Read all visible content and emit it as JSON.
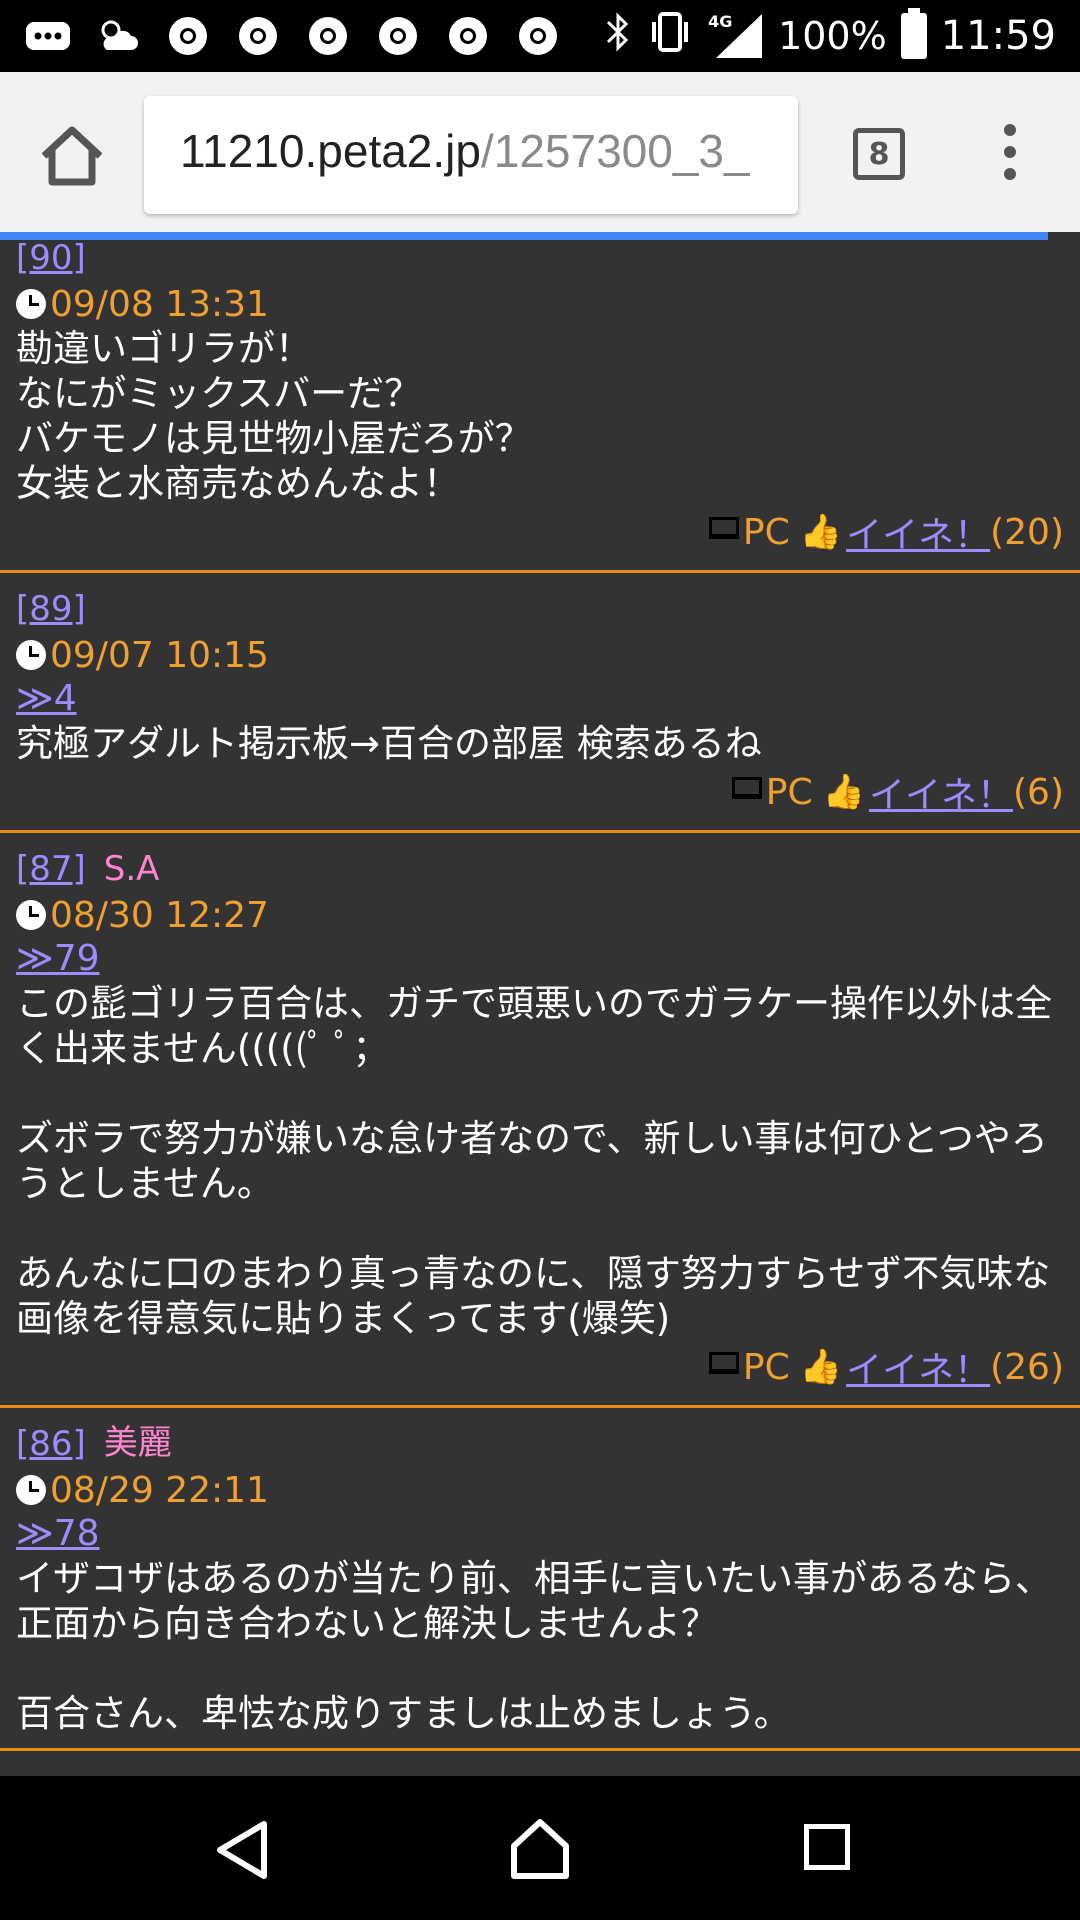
{
  "status_bar": {
    "battery": "100%",
    "time": "11:59",
    "network": "4G",
    "icons": [
      "more-icon",
      "weather-icon",
      "chrome-icon",
      "chrome-icon",
      "chrome-icon",
      "chrome-icon",
      "chrome-icon",
      "chrome-icon",
      "bluetooth-icon",
      "vibrate-icon",
      "signal-icon",
      "battery-icon"
    ]
  },
  "browser": {
    "url_host": "11210.peta2.jp",
    "url_path": "/1257300_3_",
    "tab_count": "8"
  },
  "posts": [
    {
      "number": "[90]",
      "author": "",
      "date": "09/08 13:31",
      "reply": "",
      "body": "勘違いゴリラが！\nなにがミックスバーだ？\nバケモノは見世物小屋だろが？\n女装と水商売なめんなよ！",
      "device": "PC",
      "like_label": "イイネ！",
      "like_count": "(20)"
    },
    {
      "number": "[89]",
      "author": "",
      "date": "09/07 10:15",
      "reply": "≫4",
      "body": "究極アダルト掲示板→百合の部屋 検索あるね",
      "device": "PC",
      "like_label": "イイネ！",
      "like_count": "(6)"
    },
    {
      "number": "[87]",
      "author": "S.A",
      "date": "08/30 12:27",
      "reply": "≫79",
      "body": "この髭ゴリラ百合は、ガチで頭悪いのでガラケー操作以外は全く出来ません(((((ﾟ ﾟ；\n\nズボラで努力が嫌いな怠け者なので、新しい事は何ひとつやろうとしません。\n\nあんなに口のまわり真っ青なのに、隠す努力すらせず不気味な画像を得意気に貼りまくってます(爆笑)",
      "device": "PC",
      "like_label": "イイネ！",
      "like_count": "(26)"
    },
    {
      "number": "[86]",
      "author": "美麗",
      "date": "08/29 22:11",
      "reply": "≫78",
      "body": "イザコザはあるのが当たり前、相手に言いたい事があるなら、正面から向き合わないと解決しませんよ？\n\n百合さん、卑怯な成りすましは止めましょう。",
      "device": "",
      "like_label": "",
      "like_count": ""
    }
  ]
}
